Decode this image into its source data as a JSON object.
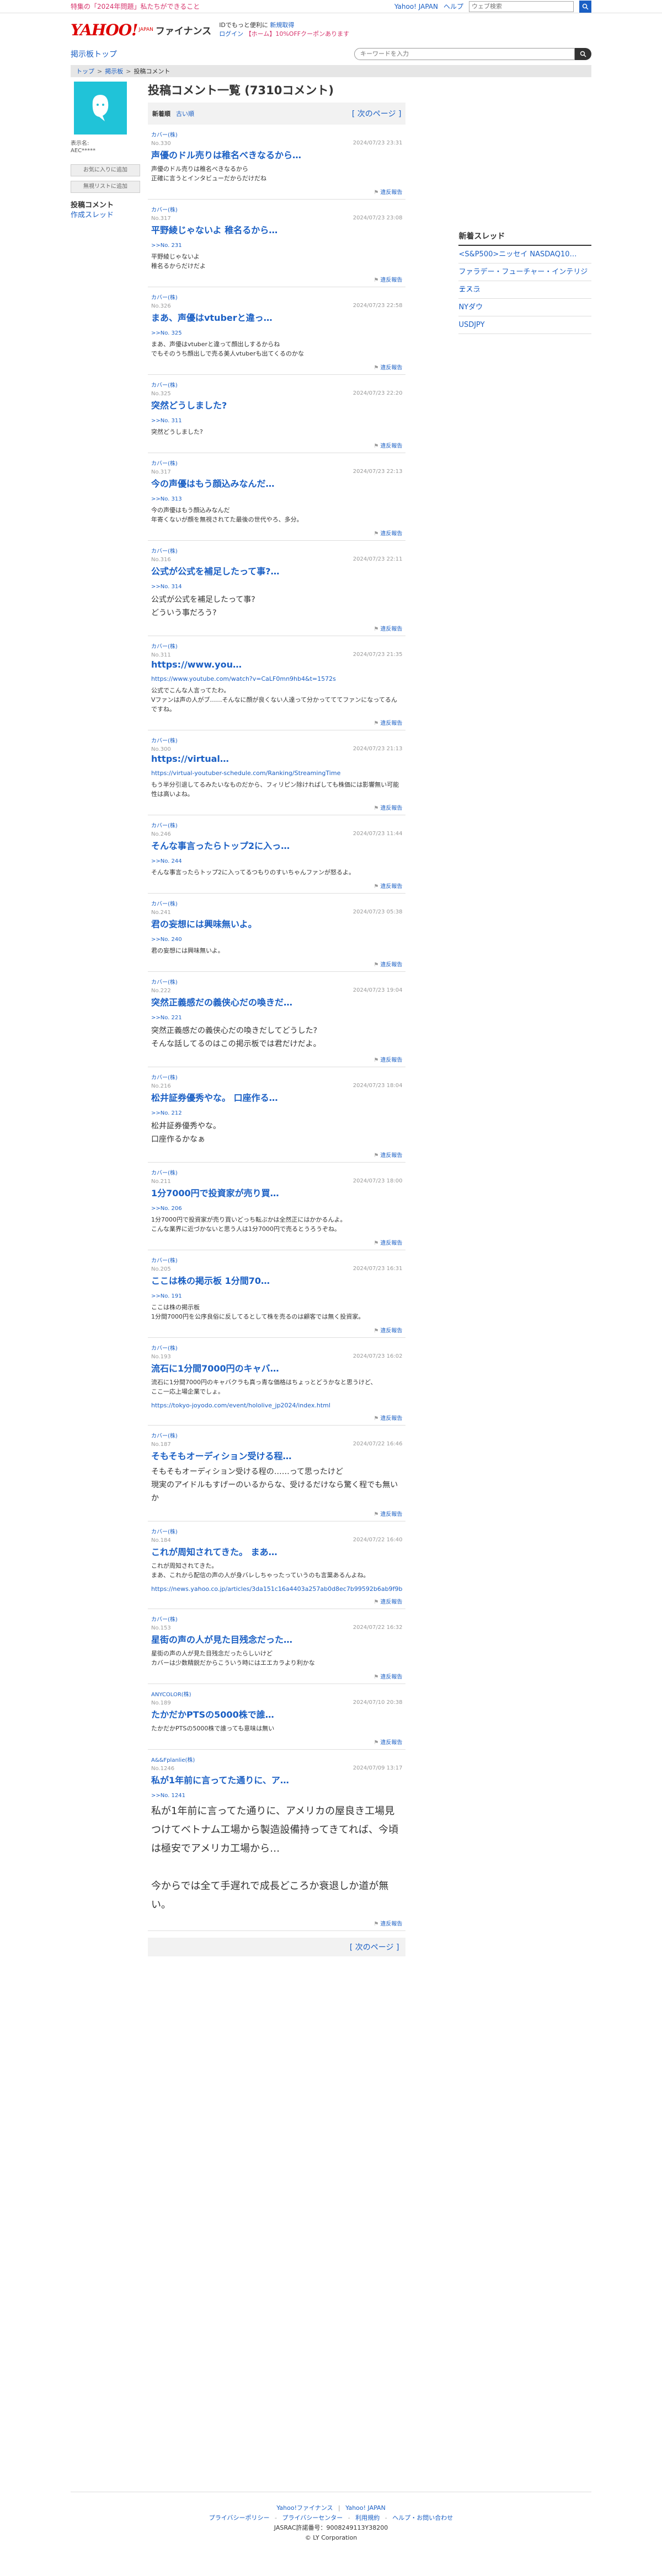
{
  "topbar": {
    "promo": "特集の「2024年問題」私たちができること",
    "yahoo_japan": "Yahoo! JAPAN",
    "help": "ヘルプ",
    "web_search_placeholder": "ウェブ検索"
  },
  "header": {
    "logo": "YAHOO!",
    "logo_sub": "JAPAN",
    "finance": "ファイナンス",
    "tagline": "IDでもっと便利に",
    "new_register": "新規取得",
    "login": "ログイン",
    "coupon": "【ホーム】10%OFFクーポンあります"
  },
  "nav": {
    "forum_top": "掲示板トップ",
    "keyword_placeholder": "キーワードを入力"
  },
  "breadcrumb": [
    "トップ",
    "掲示板",
    "投稿コメント"
  ],
  "profile": {
    "display_name_label": "表示名:",
    "display_name": "AEC*****",
    "add_favorite": "お気に入りに追加",
    "add_blocklist": "無視リストに追加"
  },
  "left_menu": [
    "投稿コメント",
    "作成スレッド"
  ],
  "page": {
    "title": "投稿コメント一覧 (7310コメント)",
    "tab_new": "新着順",
    "tab_old": "古い順",
    "next_page": "[ 次のページ ]"
  },
  "report_label": "違反報告",
  "posts": [
    {
      "company": "カバー(株)",
      "no": "No.330",
      "date": "2024/07/23 23:31",
      "title": "声優のドル売りは稚名べきなるから…",
      "reply": "",
      "body": "声優のドル売りは稚名べきなるから\n正確に言うとインタビューだからだけだね",
      "link": "",
      "size": "normal"
    },
    {
      "company": "カバー(株)",
      "no": "No.317",
      "date": "2024/07/23 23:08",
      "title": "平野綾じゃないよ 稚名るから…",
      "reply": ">>No. 231",
      "body": "平野綾じゃないよ\n稚名るからだけだよ",
      "link": "",
      "size": "normal"
    },
    {
      "company": "カバー(株)",
      "no": "No.326",
      "date": "2024/07/23 22:58",
      "title": "まあ、声優はvtuberと違っ…",
      "reply": ">>No. 325",
      "body": "まあ、声優はvtuberと違って顔出しするからね\nでもそのうち顔出しで売る美人vtuberも出てくるのかな",
      "link": "",
      "size": "normal"
    },
    {
      "company": "カバー(株)",
      "no": "No.325",
      "date": "2024/07/23 22:20",
      "title": "突然どうしました?",
      "reply": ">>No. 311",
      "body": "突然どうしました?",
      "link": "",
      "size": "normal"
    },
    {
      "company": "カバー(株)",
      "no": "No.317",
      "date": "2024/07/23 22:13",
      "title": "今の声優はもう顔込みなんだ…",
      "reply": ">>No. 313",
      "body": "今の声優はもう顔込みなんだ\n年寄くないが顔を無視されてた最後の世代やろ、多分。",
      "link": "",
      "size": "normal"
    },
    {
      "company": "カバー(株)",
      "no": "No.316",
      "date": "2024/07/23 22:11",
      "title": "公式が公式を補足したって事?…",
      "reply": ">>No. 314",
      "body": "公式が公式を補足したって事?\nどういう事だろう?",
      "link": "",
      "size": "big"
    },
    {
      "company": "カバー(株)",
      "no": "No.311",
      "date": "2024/07/23 21:35",
      "title": "https://www.you…",
      "reply": "",
      "link_top": "https://www.youtube.com/watch?v=CaLF0mn9hb4&t=1572s",
      "body": "公式でこんな人言ってたわ。\nVファンは声の人がブ……そんなに顔が良くない人達って分かってててファンになってるんですね。",
      "link": "",
      "size": "normal"
    },
    {
      "company": "カバー(株)",
      "no": "No.300",
      "date": "2024/07/23 21:13",
      "title": "https://virtual…",
      "reply": "",
      "link_top": "https://virtual-youtuber-schedule.com/Ranking/StreamingTime",
      "body": "もう半分引退してるみたいなものだから、フィリピン除ければしても株価には影響無い可能性は高いよね。",
      "link": "",
      "size": "normal"
    },
    {
      "company": "カバー(株)",
      "no": "No.246",
      "date": "2024/07/23 11:44",
      "title": "そんな事言ったらトップ2に入っ…",
      "reply": ">>No. 244",
      "body": "そんな事言ったらトップ2に入ってるつもりのすいちゃんファンが怒るよ。",
      "link": "",
      "size": "normal"
    },
    {
      "company": "カバー(株)",
      "no": "No.241",
      "date": "2024/07/23 05:38",
      "title": "君の妄想には興味無いよ。",
      "reply": ">>No. 240",
      "body": "君の妄想には興味無いよ。",
      "link": "",
      "size": "normal"
    },
    {
      "company": "カバー(株)",
      "no": "No.222",
      "date": "2024/07/23 19:04",
      "title": "突然正義感だの義侠心だの喚きだ…",
      "reply": ">>No. 221",
      "body": "突然正義感だの義侠心だの喚きだしてどうした?\nそんな話してるのはこの掲示板では君だけだよ。",
      "link": "",
      "size": "big"
    },
    {
      "company": "カバー(株)",
      "no": "No.216",
      "date": "2024/07/23 18:04",
      "title": "松井証券優秀やな。 口座作る…",
      "reply": ">>No. 212",
      "body": "松井証券優秀やな。\n口座作るかなぁ",
      "link": "",
      "size": "big"
    },
    {
      "company": "カバー(株)",
      "no": "No.211",
      "date": "2024/07/23 18:00",
      "title": "1分7000円で投資家が売り買…",
      "reply": ">>No. 206",
      "body": "1分7000円で投資家が売り買いどっち転ぶかは全然正にはかかるんよ。\nこんな業界に近づかないと思う人は1分7000円で売るとうろうぞね。",
      "link": "",
      "size": "normal"
    },
    {
      "company": "カバー(株)",
      "no": "No.205",
      "date": "2024/07/23 16:31",
      "title": "ここは株の掲示板 1分間70…",
      "reply": ">>No. 191",
      "body": "ここは株の掲示板\n1分間7000円を公序良俗に反してるとして株を売るのは顧客では無く投資家。",
      "link": "",
      "size": "normal"
    },
    {
      "company": "カバー(株)",
      "no": "No.193",
      "date": "2024/07/23 16:02",
      "title": "流石に1分間7000円のキャバ…",
      "reply": "",
      "body": "流石に1分間7000円のキャバクラも真っ青な価格はちょっとどうかなと思うけど、\nここ一応上場企業でしょ。",
      "link": "https://tokyo-joyodo.com/event/hololive_jp2024/index.html",
      "size": "normal"
    },
    {
      "company": "カバー(株)",
      "no": "No.187",
      "date": "2024/07/22 16:46",
      "title": "そもそもオーディション受ける程…",
      "reply": "",
      "body": "そもそもオーディション受ける程の……って思ったけど\n現実のアイドルもすげーのいるからな、受けるだけなら驚く程でも無いか",
      "link": "",
      "size": "big"
    },
    {
      "company": "カバー(株)",
      "no": "No.184",
      "date": "2024/07/22 16:40",
      "title": "これが周知されてきた。 まあ…",
      "reply": "",
      "body": "これが周知されてきた。\nまあ、これから配信の声の人が身バレしちゃったっていうのも言葉あるんよね。",
      "link": "https://news.yahoo.co.jp/articles/3da151c16a4403a257ab0d8ec7b99592b6ab9f9b",
      "size": "normal"
    },
    {
      "company": "カバー(株)",
      "no": "No.153",
      "date": "2024/07/22 16:32",
      "title": "星街の声の人が見た目残念だった…",
      "reply": "",
      "body": "星街の声の人が見た目残念だったらしいけど\nカバーは少数精鋭だからこういう時にはエエカラより利かな",
      "link": "",
      "size": "normal"
    },
    {
      "company": "ANYCOLOR(株)",
      "no": "No.189",
      "date": "2024/07/10 20:38",
      "title": "たかだかPTSの5000株で誰…",
      "reply": "",
      "body": "たかだかPTSの5000株で誰っても意味は無い",
      "link": "",
      "size": "normal"
    },
    {
      "company": "A&&Fplanlie(株)",
      "no": "No.1246",
      "date": "2024/07/09 13:17",
      "title": "私が1年前に言ってた通りに、ア…",
      "reply": ">>No. 1241",
      "body": "私が1年前に言ってた通りに、アメリカの屋良き工場見つけてベトナム工場から製造設備持ってきてれば、今頃は極安でアメリカ工場から…\n\n今からでは全て手遅れで成長どころか衰退しか道が無い。",
      "link": "",
      "size": "xl"
    }
  ],
  "right": {
    "heading": "新着スレッド",
    "threads": [
      "<S&P500>ニッセイ NASDAQ10…",
      "ファラデー・フューチャー・インテリジェ・…",
      "テスラ",
      "NYダウ",
      "USDJPY"
    ]
  },
  "footer": {
    "links1": [
      "Yahoo!ファイナンス",
      "Yahoo! JAPAN"
    ],
    "links2": [
      "プライバシーポリシー",
      "プライバシーセンター",
      "利用規約",
      "ヘルプ・お問い合わせ"
    ],
    "license": "JASRAC許諾番号：9008249113Y38200",
    "copyright": "© LY Corporation"
  },
  "colors": {
    "link": "#1a5fc4",
    "logo_red": "#dd0000",
    "avatar": "#20c3d8",
    "promo": "#d6336c"
  }
}
